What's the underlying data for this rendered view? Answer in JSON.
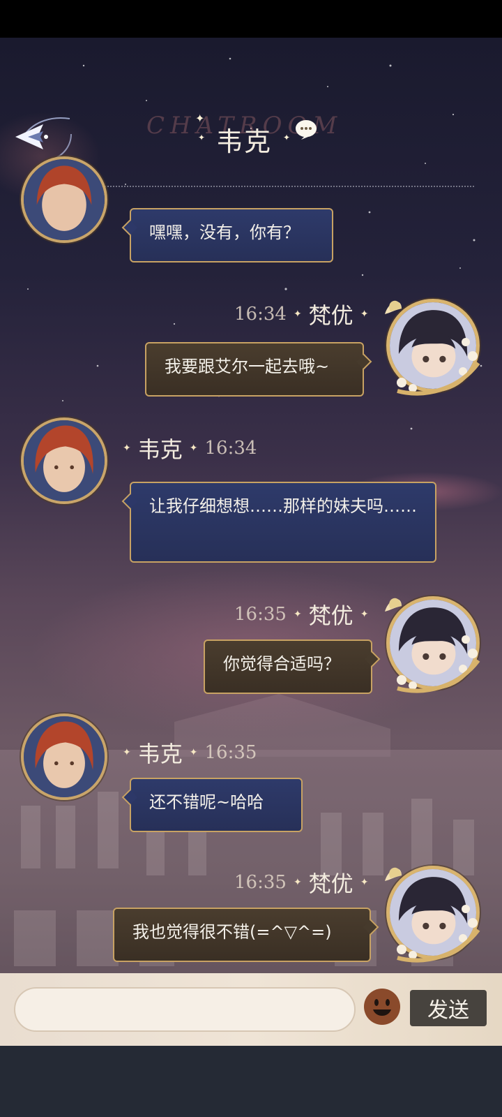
{
  "header": {
    "watermark": "CHATROOM",
    "title": "韦克",
    "back_icon": "back-arrow-icon",
    "chat_icon": "speech-bubble-icon"
  },
  "messages": [
    {
      "side": "left",
      "name": "",
      "time": "",
      "text": "嘿嘿，没有，你有？"
    },
    {
      "side": "right",
      "name": "梵优",
      "time": "16:34",
      "text": "我要跟艾尔一起去哦~"
    },
    {
      "side": "left",
      "name": "韦克",
      "time": "16:34",
      "text": "让我仔细想想……那样的妹夫吗……"
    },
    {
      "side": "right",
      "name": "梵优",
      "time": "16:35",
      "text": "你觉得合适吗？"
    },
    {
      "side": "left",
      "name": "韦克",
      "time": "16:35",
      "text": "还不错呢~哈哈"
    },
    {
      "side": "right",
      "name": "梵优",
      "time": "16:35",
      "text": "我也觉得很不错(=^▽^=)"
    }
  ],
  "input": {
    "placeholder": "",
    "emoji_icon": "emoji-smile-icon",
    "send_label": "发送"
  },
  "colors": {
    "bubble_left": "#2e3a6a",
    "bubble_right": "#4a3d2e",
    "gold_border": "#c8a263",
    "send_button": "#47433e"
  }
}
